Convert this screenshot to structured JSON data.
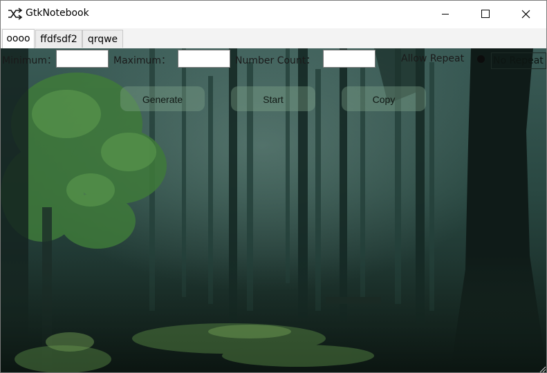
{
  "window": {
    "title": "GtkNotebook"
  },
  "tabs": [
    {
      "label": "oooo",
      "active": true
    },
    {
      "label": "ffdfsdf2",
      "active": false
    },
    {
      "label": "qrqwe",
      "active": false
    }
  ],
  "form": {
    "minimum_label": "Minimum：",
    "minimum_value": "",
    "maximum_label": "Maximum：",
    "maximum_value": "",
    "count_label": "Number Count：",
    "count_value": "",
    "allow_repeat_label": "Allow Repeat",
    "no_repeat_label": "No Repeat"
  },
  "buttons": {
    "generate": "Generate",
    "start": "Start",
    "copy": "Copy"
  },
  "colors": {
    "forest_dark": "#0d1c1a",
    "forest_mid": "#2c4a44",
    "foliage": "#3e7a3c"
  }
}
